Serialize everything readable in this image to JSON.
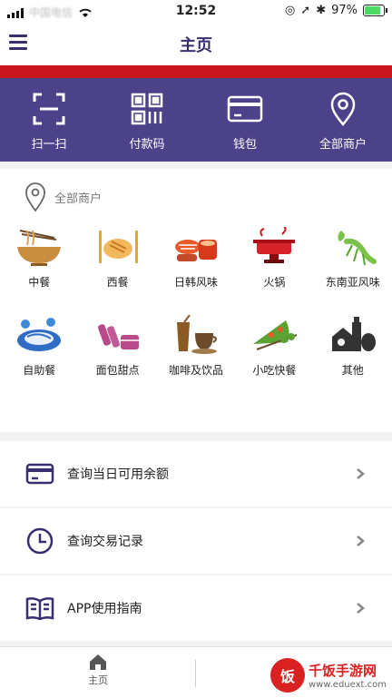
{
  "status": {
    "carrier": "中国电信",
    "time": "12:52",
    "battery": "97%"
  },
  "navbar": {
    "title": "主页"
  },
  "quick_actions": [
    {
      "label": "扫一扫",
      "icon": "scan-icon"
    },
    {
      "label": "付款码",
      "icon": "qr-code-icon"
    },
    {
      "label": "钱包",
      "icon": "wallet-icon"
    },
    {
      "label": "全部商户",
      "icon": "location-pin-icon"
    }
  ],
  "categories": {
    "header": "全部商户",
    "items": [
      {
        "label": "中餐",
        "icon": "noodle-bowl-icon"
      },
      {
        "label": "西餐",
        "icon": "steak-cutlery-icon"
      },
      {
        "label": "日韩风味",
        "icon": "sushi-icon"
      },
      {
        "label": "火锅",
        "icon": "hotpot-icon"
      },
      {
        "label": "东南亚风味",
        "icon": "lobster-icon"
      },
      {
        "label": "自助餐",
        "icon": "buffet-plate-icon"
      },
      {
        "label": "面包甜点",
        "icon": "dessert-icon"
      },
      {
        "label": "咖啡及饮品",
        "icon": "coffee-drink-icon"
      },
      {
        "label": "小吃快餐",
        "icon": "pizza-skewer-icon"
      },
      {
        "label": "其他",
        "icon": "other-food-icon"
      }
    ]
  },
  "menu_rows": [
    {
      "label": "查询当日可用余额",
      "icon": "card-icon"
    },
    {
      "label": "查询交易记录",
      "icon": "clock-icon"
    },
    {
      "label": "APP使用指南",
      "icon": "book-icon"
    }
  ],
  "tabbar": {
    "home_label": "主页"
  },
  "watermark": {
    "badge": "饭",
    "title": "千饭手游网",
    "url": "www.eduext.com"
  },
  "colors": {
    "primary": "#4c4289",
    "accent_red": "#c9151e"
  }
}
